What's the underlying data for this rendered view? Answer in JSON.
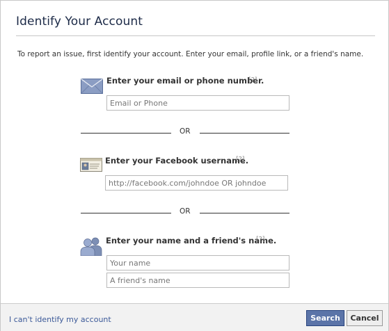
{
  "dialog": {
    "title": "Identify Your Account",
    "intro": "To report an issue, first identify your account. Enter your email, profile link, or a friend's name."
  },
  "email_section": {
    "heading": "Enter your email or phone number.",
    "help": "[?]",
    "placeholder": "Email or Phone"
  },
  "or_1": "OR",
  "username_section": {
    "heading": "Enter your Facebook username.",
    "help": "[?]",
    "placeholder": "http://facebook.com/johndoe OR johndoe"
  },
  "or_2": "OR",
  "name_section": {
    "heading": "Enter your name and a friend's name.",
    "help": "[?]",
    "your_name_placeholder": "Your name",
    "friend_name_placeholder": "A friend's name"
  },
  "footer": {
    "cant_identify_link": "I can't identify my account",
    "search_label": "Search",
    "cancel_label": "Cancel"
  },
  "colors": {
    "link": "#3b5998",
    "primary_button": "#5b74a8",
    "title": "#1c2a47"
  }
}
